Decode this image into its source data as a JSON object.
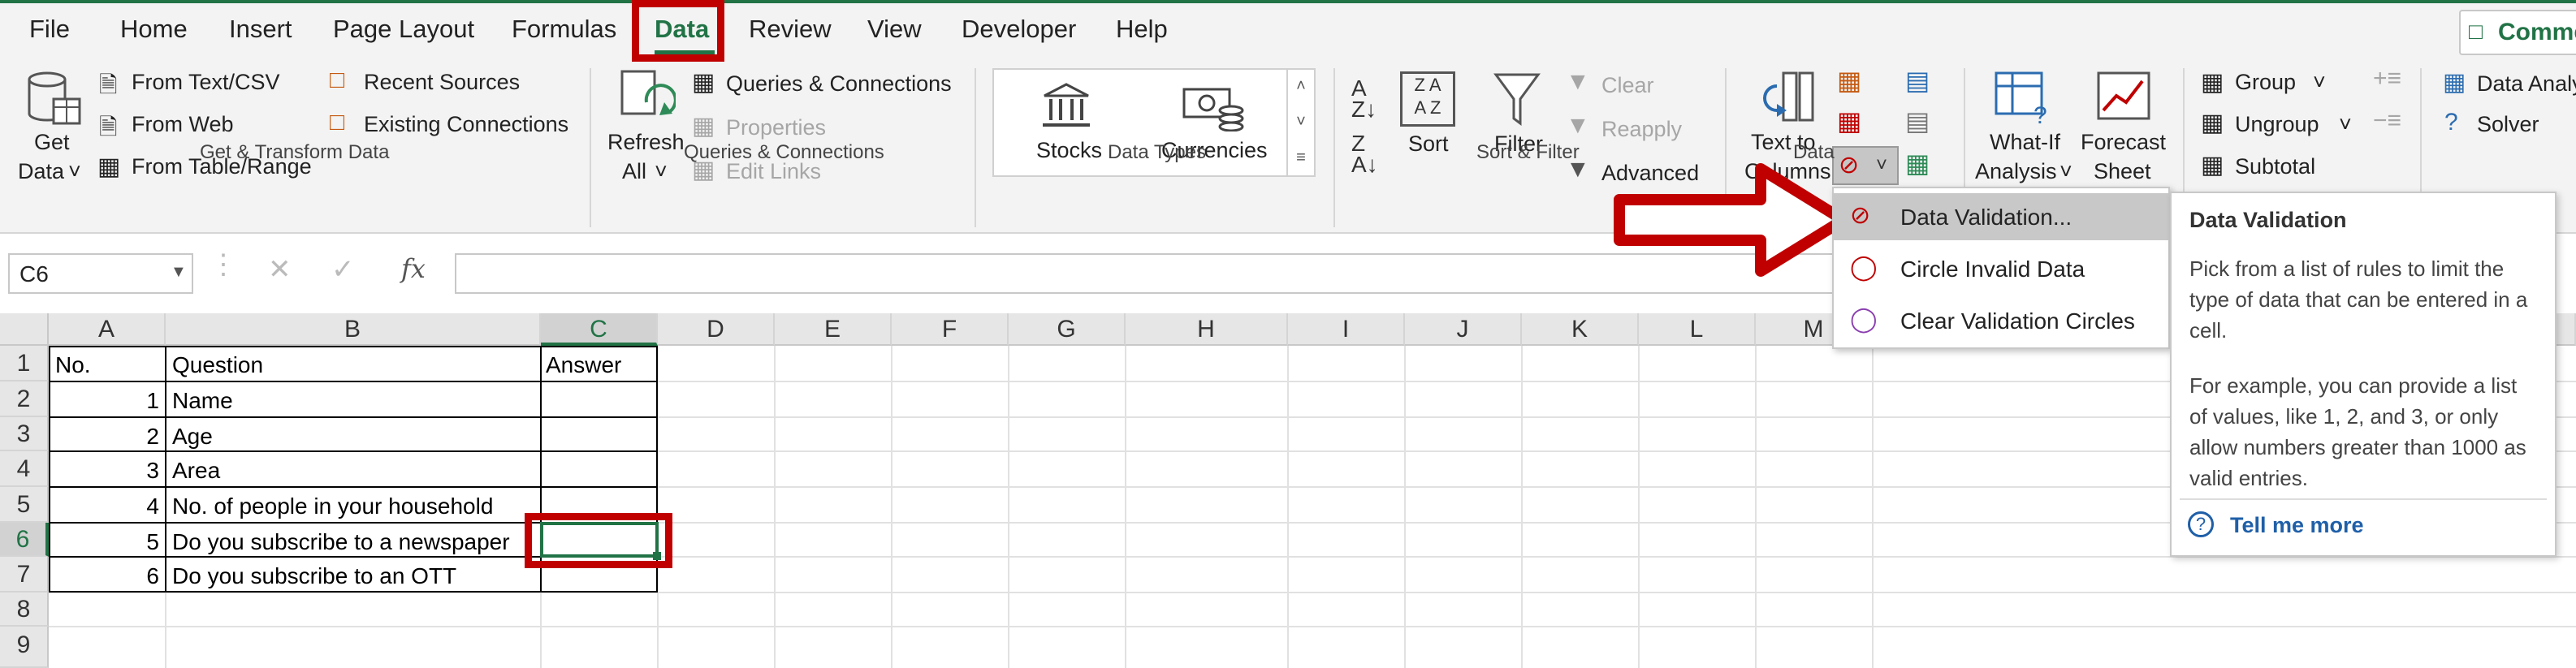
{
  "menu": {
    "tabs": [
      "File",
      "Home",
      "Insert",
      "Page Layout",
      "Formulas",
      "Data",
      "Review",
      "View",
      "Developer",
      "Help"
    ],
    "active_tab": "Data",
    "comments_label": "Comme"
  },
  "ribbon": {
    "get_transform": {
      "get_data_line1": "Get",
      "get_data_line2": "Data",
      "from_text_csv": "From Text/CSV",
      "from_web": "From Web",
      "from_table_range": "From Table/Range",
      "recent_sources": "Recent Sources",
      "existing_connections": "Existing Connections",
      "group_label": "Get & Transform Data"
    },
    "queries": {
      "refresh_line1": "Refresh",
      "refresh_line2": "All",
      "queries_connections": "Queries & Connections",
      "properties": "Properties",
      "edit_links": "Edit Links",
      "group_label": "Queries & Connections"
    },
    "data_types": {
      "stocks": "Stocks",
      "currencies": "Currencies",
      "group_label": "Data Types"
    },
    "sort_filter": {
      "sort": "Sort",
      "filter": "Filter",
      "clear": "Clear",
      "reapply": "Reapply",
      "advanced": "Advanced",
      "group_label": "Sort & Filter"
    },
    "data_tools": {
      "text_to_columns_line1": "Text to",
      "text_to_columns_line2": "Columns",
      "group_label": "Data"
    },
    "forecast": {
      "what_if_line1": "What-If",
      "what_if_line2": "Analysis",
      "forecast_line1": "Forecast",
      "forecast_line2": "Sheet"
    },
    "outline": {
      "group": "Group",
      "ungroup": "Ungroup",
      "subtotal": "Subtotal"
    },
    "analyze": {
      "data_analysis": "Data Analy",
      "solver": "Solver"
    }
  },
  "formula_bar": {
    "name_box": "C6",
    "fx": "fx",
    "value": ""
  },
  "sheet": {
    "columns": [
      "A",
      "B",
      "C",
      "D",
      "E",
      "F",
      "G",
      "H",
      "I",
      "J",
      "K",
      "L",
      "M"
    ],
    "rows": [
      "1",
      "2",
      "3",
      "4",
      "5",
      "6",
      "7",
      "8",
      "9"
    ],
    "headers": {
      "a": "No.",
      "b": "Question",
      "c": "Answer"
    },
    "data": [
      {
        "no": "1",
        "question": "Name"
      },
      {
        "no": "2",
        "question": "Age"
      },
      {
        "no": "3",
        "question": "Area"
      },
      {
        "no": "4",
        "question": "No. of people in your household"
      },
      {
        "no": "5",
        "question": "Do you subscribe to a newspaper"
      },
      {
        "no": "6",
        "question": "Do you subscribe to an OTT"
      }
    ],
    "selected_cell": "C6"
  },
  "dropdown": {
    "items": [
      "Data Validation...",
      "Circle Invalid Data",
      "Clear Validation Circles"
    ]
  },
  "tooltip": {
    "title": "Data Validation",
    "body1": "Pick from a list of rules to limit the type of data that can be entered in a cell.",
    "body2": "For example, you can provide a list of values, like 1, 2, and 3, or only allow numbers greater than 1000 as valid entries.",
    "link": "Tell me more"
  },
  "colors": {
    "accent": "#217346",
    "highlight": "#c00000",
    "link": "#1f5fa8"
  }
}
